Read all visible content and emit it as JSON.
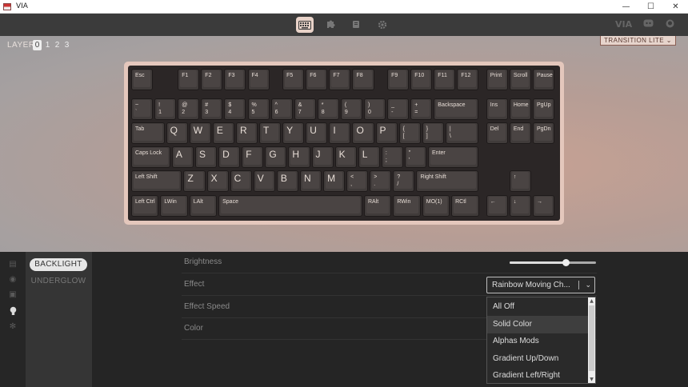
{
  "window": {
    "title": "VIA",
    "buttons": [
      "—",
      "☐",
      "✕"
    ]
  },
  "toolbar": {
    "right_logo": "VIA",
    "icons": [
      "keyboard-icon",
      "puzzle-icon",
      "bug-icon",
      "gear-icon",
      "discord-icon",
      "github-icon"
    ]
  },
  "layers": {
    "label": "LAYER",
    "items": [
      "0",
      "1",
      "2",
      "3"
    ],
    "active": "0"
  },
  "lighting_profile": "TRANSITION LITE",
  "keyboard": {
    "rows": [
      [
        "Esc",
        "F1",
        "F2",
        "F3",
        "F4",
        "F5",
        "F6",
        "F7",
        "F8",
        "F9",
        "F10",
        "F11",
        "F12",
        "Print",
        "Scroll",
        "Pause"
      ],
      [
        "~\n`",
        "!\n1",
        "@\n2",
        "#\n3",
        "$\n4",
        "%\n5",
        "^\n6",
        "&\n7",
        "*\n8",
        "(\n9",
        ")\n0",
        "_\n-",
        "+\n=",
        "Backspace",
        "Ins",
        "Home",
        "PgUp"
      ],
      [
        "Tab",
        "Q",
        "W",
        "E",
        "R",
        "T",
        "Y",
        "U",
        "I",
        "O",
        "P",
        "{\n[",
        "}\n]",
        "|\n\\",
        "Del",
        "End",
        "PgDn"
      ],
      [
        "Caps Lock",
        "A",
        "S",
        "D",
        "F",
        "G",
        "H",
        "J",
        "K",
        "L",
        ":\n;",
        "\"\n'",
        "Enter"
      ],
      [
        "Left Shift",
        "Z",
        "X",
        "C",
        "V",
        "B",
        "N",
        "M",
        "<\n,",
        ">\n.",
        "?\n/",
        "Right Shift",
        "↑"
      ],
      [
        "Left Ctrl",
        "LWin",
        "LAlt",
        "Space",
        "RAlt",
        "RWin",
        "MO(1)",
        "RCtl",
        "←",
        "↓",
        "→"
      ]
    ]
  },
  "sidebar": {
    "icons": [
      "save-icon",
      "circle-icon",
      "floppy-icon",
      "bulb-icon",
      "gear-icon"
    ],
    "active_icon": "bulb-icon"
  },
  "submenu": {
    "items": [
      "BACKLIGHT",
      "UNDERGLOW"
    ],
    "active": "BACKLIGHT"
  },
  "settings": {
    "brightness_label": "Brightness",
    "brightness_value": 0.65,
    "effect_label": "Effect",
    "effect_value": "Rainbow Moving Ch...",
    "effect_speed_label": "Effect Speed",
    "color_label": "Color"
  },
  "dropdown": {
    "options": [
      "All Off",
      "Solid Color",
      "Alphas Mods",
      "Gradient Up/Down",
      "Gradient Left/Right"
    ],
    "hovered": "Solid Color"
  },
  "colors": {
    "accent": "#e8d2c8",
    "toolbar": "#3b3b3b",
    "panel": "#252525"
  }
}
